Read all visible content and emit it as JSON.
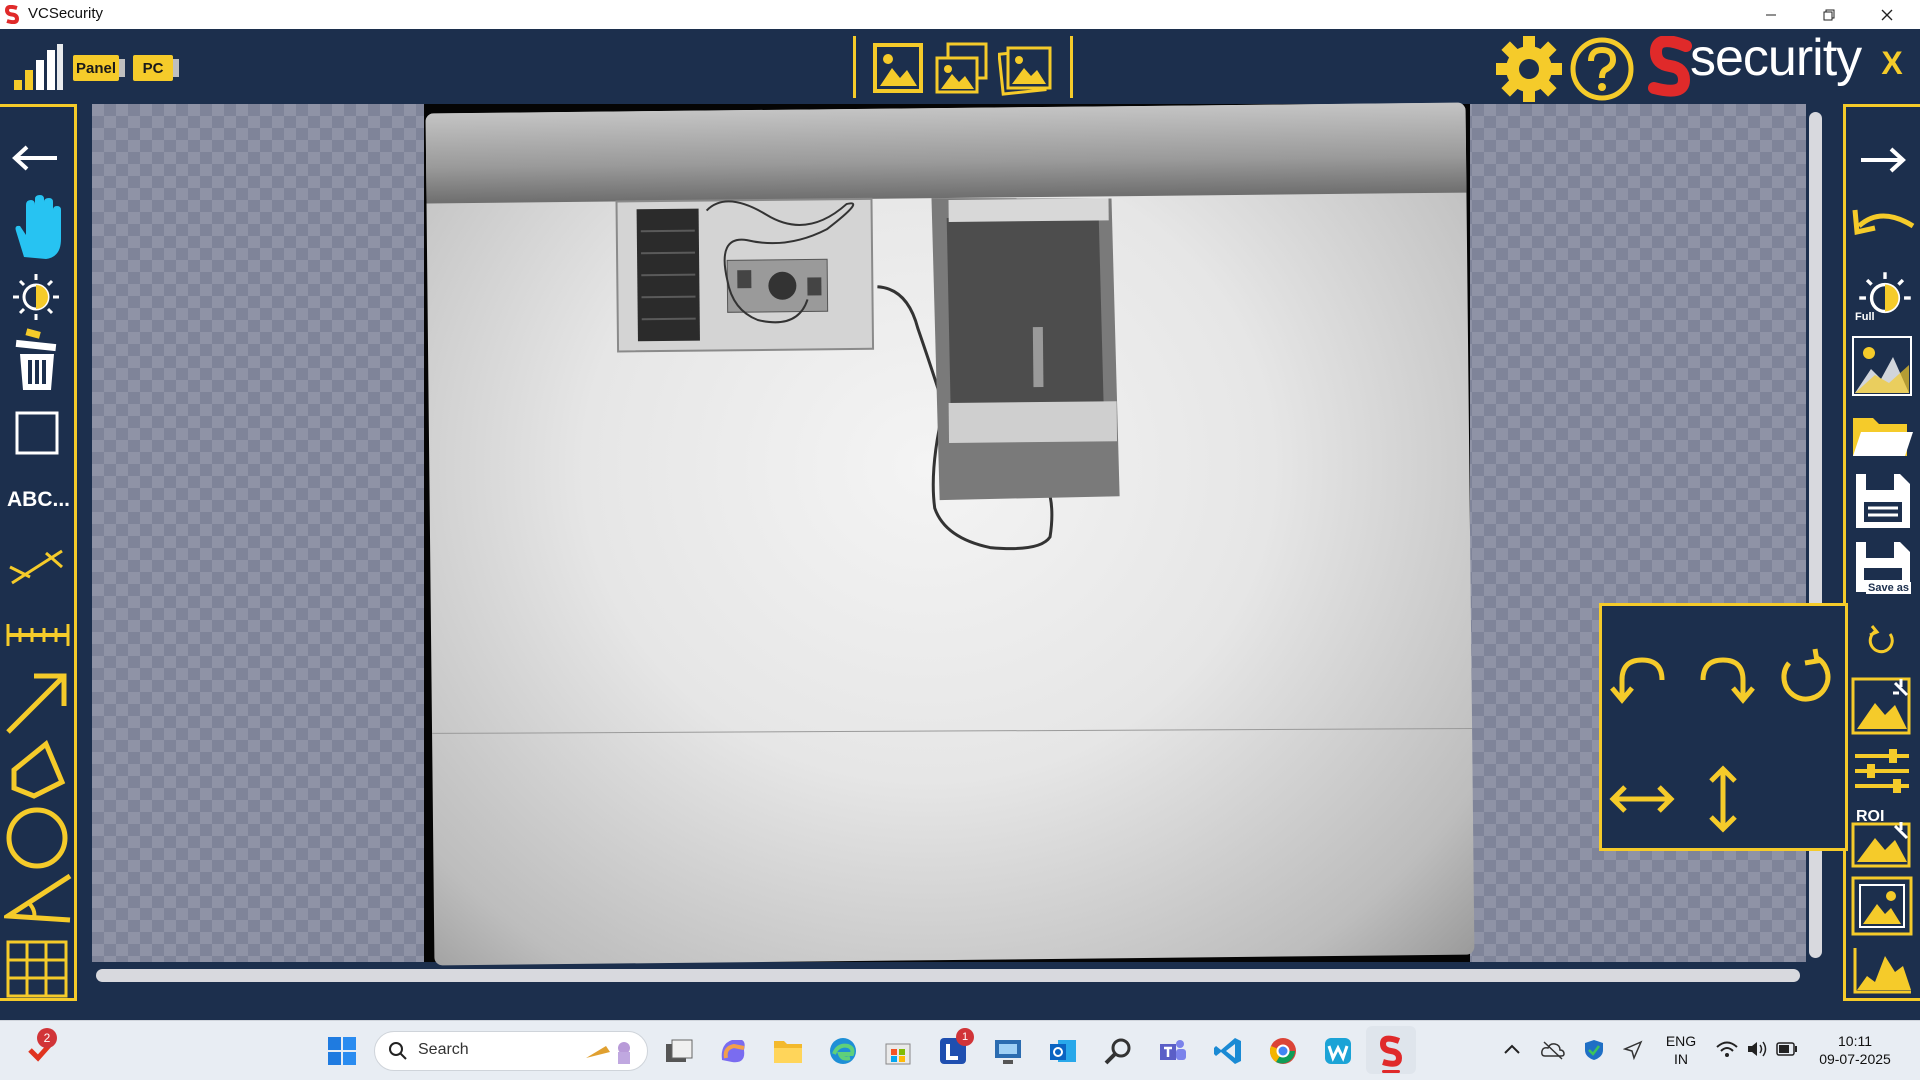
{
  "window": {
    "title": "VCSecurity"
  },
  "topbar": {
    "panel_label": "Panel",
    "pc_label": "PC",
    "brand_text": "security",
    "close_label": "X"
  },
  "left_toolbar": {
    "text_tool_label": "ABC..."
  },
  "right_toolbar": {
    "full_label": "Full",
    "save_as_label": "Save as",
    "roi_label": "ROI"
  },
  "taskbar": {
    "search_placeholder": "Search",
    "notification_count": "2",
    "app_badge_count": "1",
    "language_line1": "ENG",
    "language_line2": "IN",
    "time": "10:11",
    "date": "09-07-2025"
  },
  "colors": {
    "panel_bg": "#1c2f4d",
    "accent_yellow": "#f5cb2a",
    "brand_red": "#e02a2a"
  }
}
